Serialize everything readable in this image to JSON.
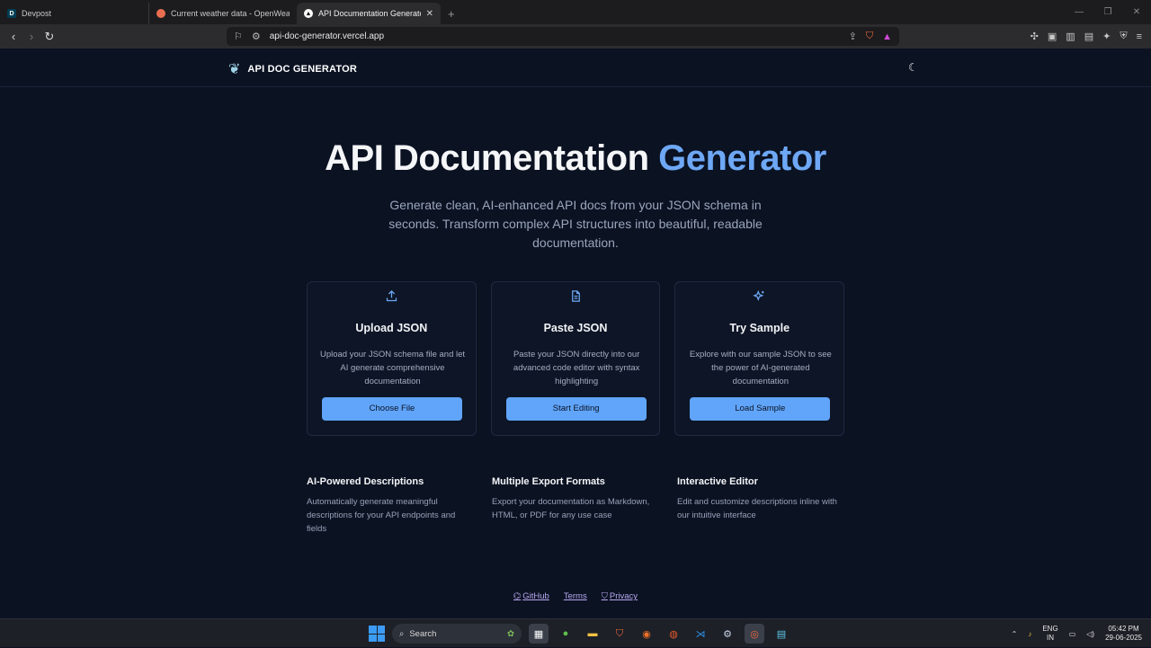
{
  "browser": {
    "tabs": [
      {
        "label": "Devpost",
        "fav": "D",
        "favColor": "#003e54"
      },
      {
        "label": "Current weather data - OpenWeathe",
        "fav": "●",
        "favColor": "#e96e50"
      },
      {
        "label": "API Documentation Generator -",
        "fav": "▲",
        "favColor": "#000000"
      }
    ],
    "new_tab": "+",
    "url": "api-doc-generator.vercel.app"
  },
  "page": {
    "brand": "API DOC GENERATOR",
    "hero_title": "API Documentation",
    "hero_accent": "Generator",
    "hero_subtitle": "Generate clean, AI-enhanced API docs from your JSON schema in seconds. Transform complex API structures into beautiful, readable documentation.",
    "cards": [
      {
        "title": "Upload JSON",
        "desc": "Upload your JSON schema file and let AI generate comprehensive documentation",
        "button": "Choose File",
        "icon": "upload-icon"
      },
      {
        "title": "Paste JSON",
        "desc": "Paste your JSON directly into our advanced code editor with syntax highlighting",
        "button": "Start Editing",
        "icon": "document-icon"
      },
      {
        "title": "Try Sample",
        "desc": "Explore with our sample JSON to see the power of AI-generated documentation",
        "button": "Load Sample",
        "icon": "sparkles-icon"
      }
    ],
    "features": [
      {
        "title": "AI-Powered Descriptions",
        "desc": "Automatically generate meaningful descriptions for your API endpoints and fields"
      },
      {
        "title": "Multiple Export Formats",
        "desc": "Export your documentation as Markdown, HTML, or PDF for any use case"
      },
      {
        "title": "Interactive Editor",
        "desc": "Edit and customize descriptions inline with our intuitive interface"
      }
    ],
    "footer": {
      "github": "GitHub",
      "terms": "Terms",
      "privacy": "Privacy"
    }
  },
  "taskbar": {
    "search": "Search",
    "lang_top": "ENG",
    "lang_bottom": "IN",
    "time": "05:42 PM",
    "date": "29-06-2025"
  },
  "colors": {
    "accent": "#6ea8f5",
    "button": "#60a5fa",
    "background": "#0b1222"
  }
}
